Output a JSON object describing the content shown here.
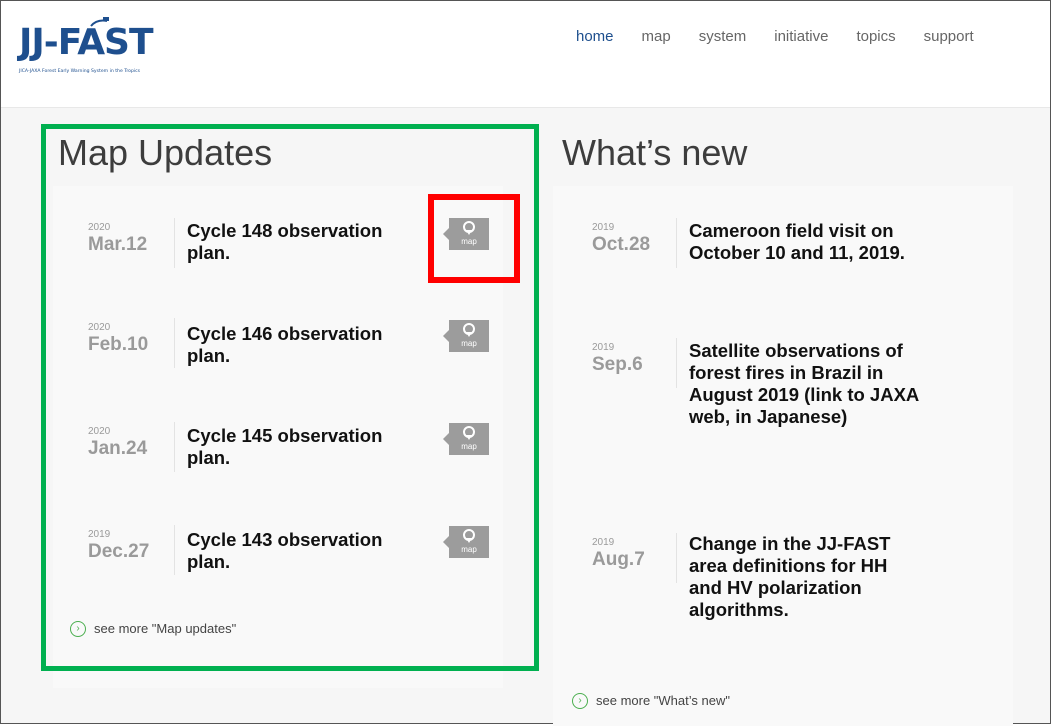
{
  "header": {
    "logo_text": "JJ-FAST",
    "logo_subtitle": "JICA-JAXA Forest Early Warning System in the Tropics",
    "nav": [
      {
        "label": "home",
        "active": true
      },
      {
        "label": "map",
        "active": false
      },
      {
        "label": "system",
        "active": false
      },
      {
        "label": "initiative",
        "active": false
      },
      {
        "label": "topics",
        "active": false
      },
      {
        "label": "support",
        "active": false
      }
    ]
  },
  "map_updates": {
    "title": "Map Updates",
    "items": [
      {
        "year": "2020",
        "date": "Mar.12",
        "title": "Cycle 148 observation plan.",
        "button": "map"
      },
      {
        "year": "2020",
        "date": "Feb.10",
        "title": "Cycle 146 observation plan.",
        "button": "map"
      },
      {
        "year": "2020",
        "date": "Jan.24",
        "title": "Cycle 145 observation plan.",
        "button": "map"
      },
      {
        "year": "2019",
        "date": "Dec.27",
        "title": "Cycle 143 observation plan.",
        "button": "map"
      }
    ],
    "see_more": "see more \"Map updates\""
  },
  "whats_new": {
    "title": "What’s new",
    "items": [
      {
        "year": "2019",
        "date": "Oct.28",
        "title": "Cameroon field visit on October 10 and 11, 2019."
      },
      {
        "year": "2019",
        "date": "Sep.6",
        "title": "Satellite observations of forest fires in Brazil in August 2019 (link to JAXA web, in Japanese)"
      },
      {
        "year": "2019",
        "date": "Aug.7",
        "title": "Change in the JJ-FAST area definitions for HH and HV polarization algorithms."
      }
    ],
    "see_more": "see more \"What’s new\""
  },
  "colors": {
    "brand": "#1e4f8e",
    "highlight_green": "#00b050",
    "highlight_red": "#ff0000",
    "map_button": "#9c9c9c"
  }
}
